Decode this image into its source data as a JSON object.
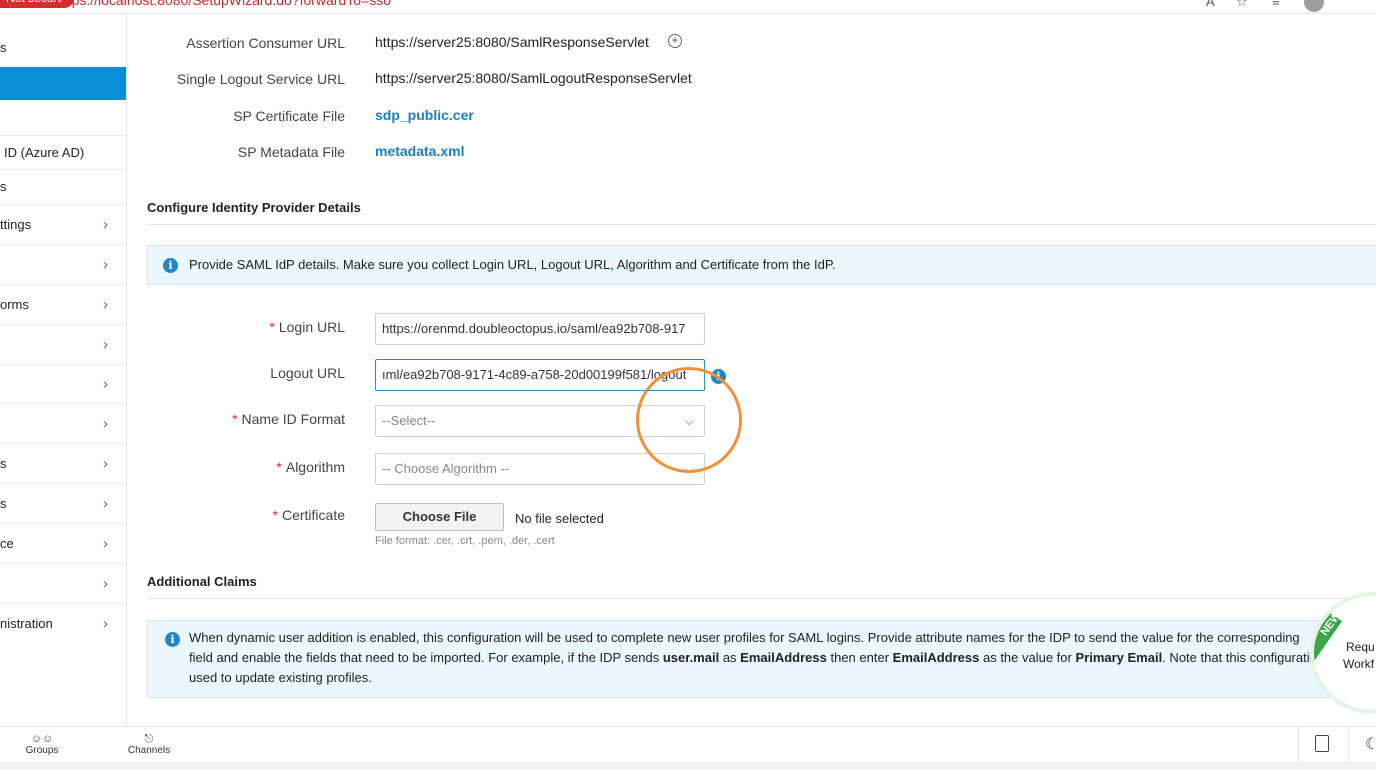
{
  "browser": {
    "security_label": "Not secure",
    "url": "https://localhost:8080/SetupWizard.do?forwardTo=sso"
  },
  "sidebar": {
    "items": [
      {
        "label": "s",
        "chevron": false
      },
      {
        "label": "",
        "chevron": false,
        "active": true
      },
      {
        "label": "",
        "chevron": false
      },
      {
        "label": "ID (Azure AD)",
        "chevron": false
      },
      {
        "label": "s",
        "chevron": false
      },
      {
        "label": "ttings",
        "chevron": true
      },
      {
        "label": "",
        "chevron": true
      },
      {
        "label": "orms",
        "chevron": true
      },
      {
        "label": "",
        "chevron": true
      },
      {
        "label": "",
        "chevron": true
      },
      {
        "label": "",
        "chevron": true
      },
      {
        "label": "s",
        "chevron": true
      },
      {
        "label": "s",
        "chevron": true
      },
      {
        "label": "ce",
        "chevron": true
      },
      {
        "label": "",
        "chevron": true
      },
      {
        "label": "nistration",
        "chevron": true
      }
    ]
  },
  "sp_details": {
    "acs_label": "Assertion Consumer URL",
    "acs_value": "https://server25:8080/SamlResponseServlet",
    "slo_label": "Single Logout Service URL",
    "slo_value": "https://server25:8080/SamlLogoutResponseServlet",
    "cert_label": "SP Certificate File",
    "cert_value": "sdp_public.cer",
    "metadata_label": "SP Metadata File",
    "metadata_value": "metadata.xml"
  },
  "idp_section": {
    "title": "Configure Identity Provider Details",
    "info": "Provide SAML IdP details. Make sure you collect Login URL, Logout URL, Algorithm and Certificate from the IdP.",
    "login_url_label": "Login URL",
    "login_url_value": "https://orenmd.doubleoctopus.io/saml/ea92b708-917",
    "logout_url_label": "Logout URL",
    "logout_url_value": "ıml/ea92b708-9171-4c89-a758-20d00199f581/logout",
    "name_id_label": "Name ID Format",
    "name_id_placeholder": "--Select--",
    "algorithm_label": "Algorithm",
    "algorithm_placeholder": "-- Choose Algorithm --",
    "certificate_label": "Certificate",
    "choose_file_label": "Choose File",
    "no_file_text": "No file selected",
    "file_format_hint": "File format: .cer, .crt, .pem, .der, .cert"
  },
  "claims_section": {
    "title": "Additional Claims",
    "info_line1": "When dynamic user addition is enabled, this configuration will be used to complete new user profiles for SAML logins. Provide attribute names for the IDP to send the value for the corresponding",
    "info_line2_a": "field and enable the fields that need to be imported. For example, if the IDP sends ",
    "info_line2_b": "user.mail",
    "info_line2_c": " as ",
    "info_line2_d": "EmailAddress",
    "info_line2_e": " then enter ",
    "info_line2_f": "EmailAddress",
    "info_line2_g": " as the value for ",
    "info_line2_h": "Primary Email",
    "info_line2_i": ". Note that this configuration w",
    "info_line3": "used to update existing profiles."
  },
  "new_badge": {
    "tag": "NEW",
    "line1": "Requ",
    "line2": "Workf"
  },
  "bottom_bar": {
    "groups_label": "Groups",
    "channels_label": "Channels"
  },
  "colors": {
    "accent": "#0a8fd6",
    "link": "#1a7fc0",
    "required": "#d32f2f",
    "highlight_ring": "#f0913a",
    "new_badge": "#3aa64a"
  }
}
